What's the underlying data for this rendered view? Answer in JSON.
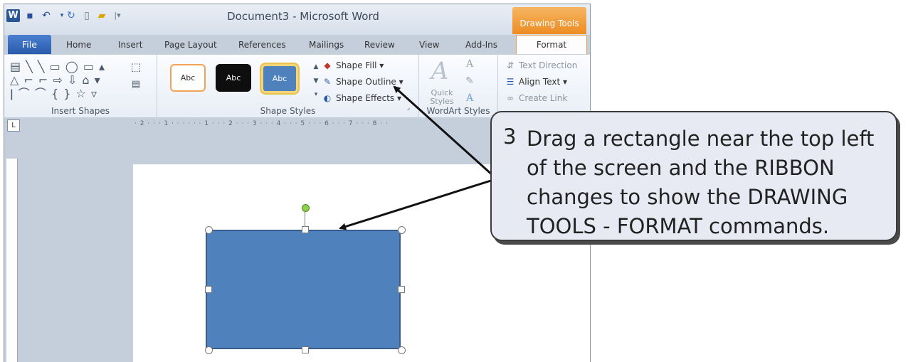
{
  "titlebar": {
    "document_title": "Document3 - Microsoft Word",
    "contextual_tab": "Drawing Tools"
  },
  "tabs": [
    "File",
    "Home",
    "Insert",
    "Page Layout",
    "References",
    "Mailings",
    "Review",
    "View",
    "Add-Ins",
    "Format"
  ],
  "ribbon": {
    "groups": {
      "insert_shapes": "Insert Shapes",
      "shape_styles": "Shape Styles",
      "wordart_styles": "WordArt Styles"
    },
    "style_previews": [
      "Abc",
      "Abc",
      "Abc"
    ],
    "shape_commands": {
      "fill": "Shape Fill",
      "outline": "Shape Outline",
      "effects": "Shape Effects"
    },
    "quick_styles": "Quick Styles",
    "text_commands": {
      "direction": "Text Direction",
      "align": "Align Text",
      "link": "Create Link"
    }
  },
  "ruler": {
    "horizontal": "· 2 · · · 1 · · · · · · 1 · · · 2 · · · 3 · · · 4 · · · 5 · · · 6 · · · 7 · · · 8 · ·",
    "tab_stop": "L"
  },
  "callout": {
    "number": "3",
    "text": "Drag a rectangle near the top left of the screen and the RIBBON changes to show the DRAWING TOOLS - FORMAT commands."
  },
  "colors": {
    "shape_fill": "#4f81bd",
    "drawing_tools_tab": "#ed8c23",
    "file_tab": "#2a5bab"
  }
}
